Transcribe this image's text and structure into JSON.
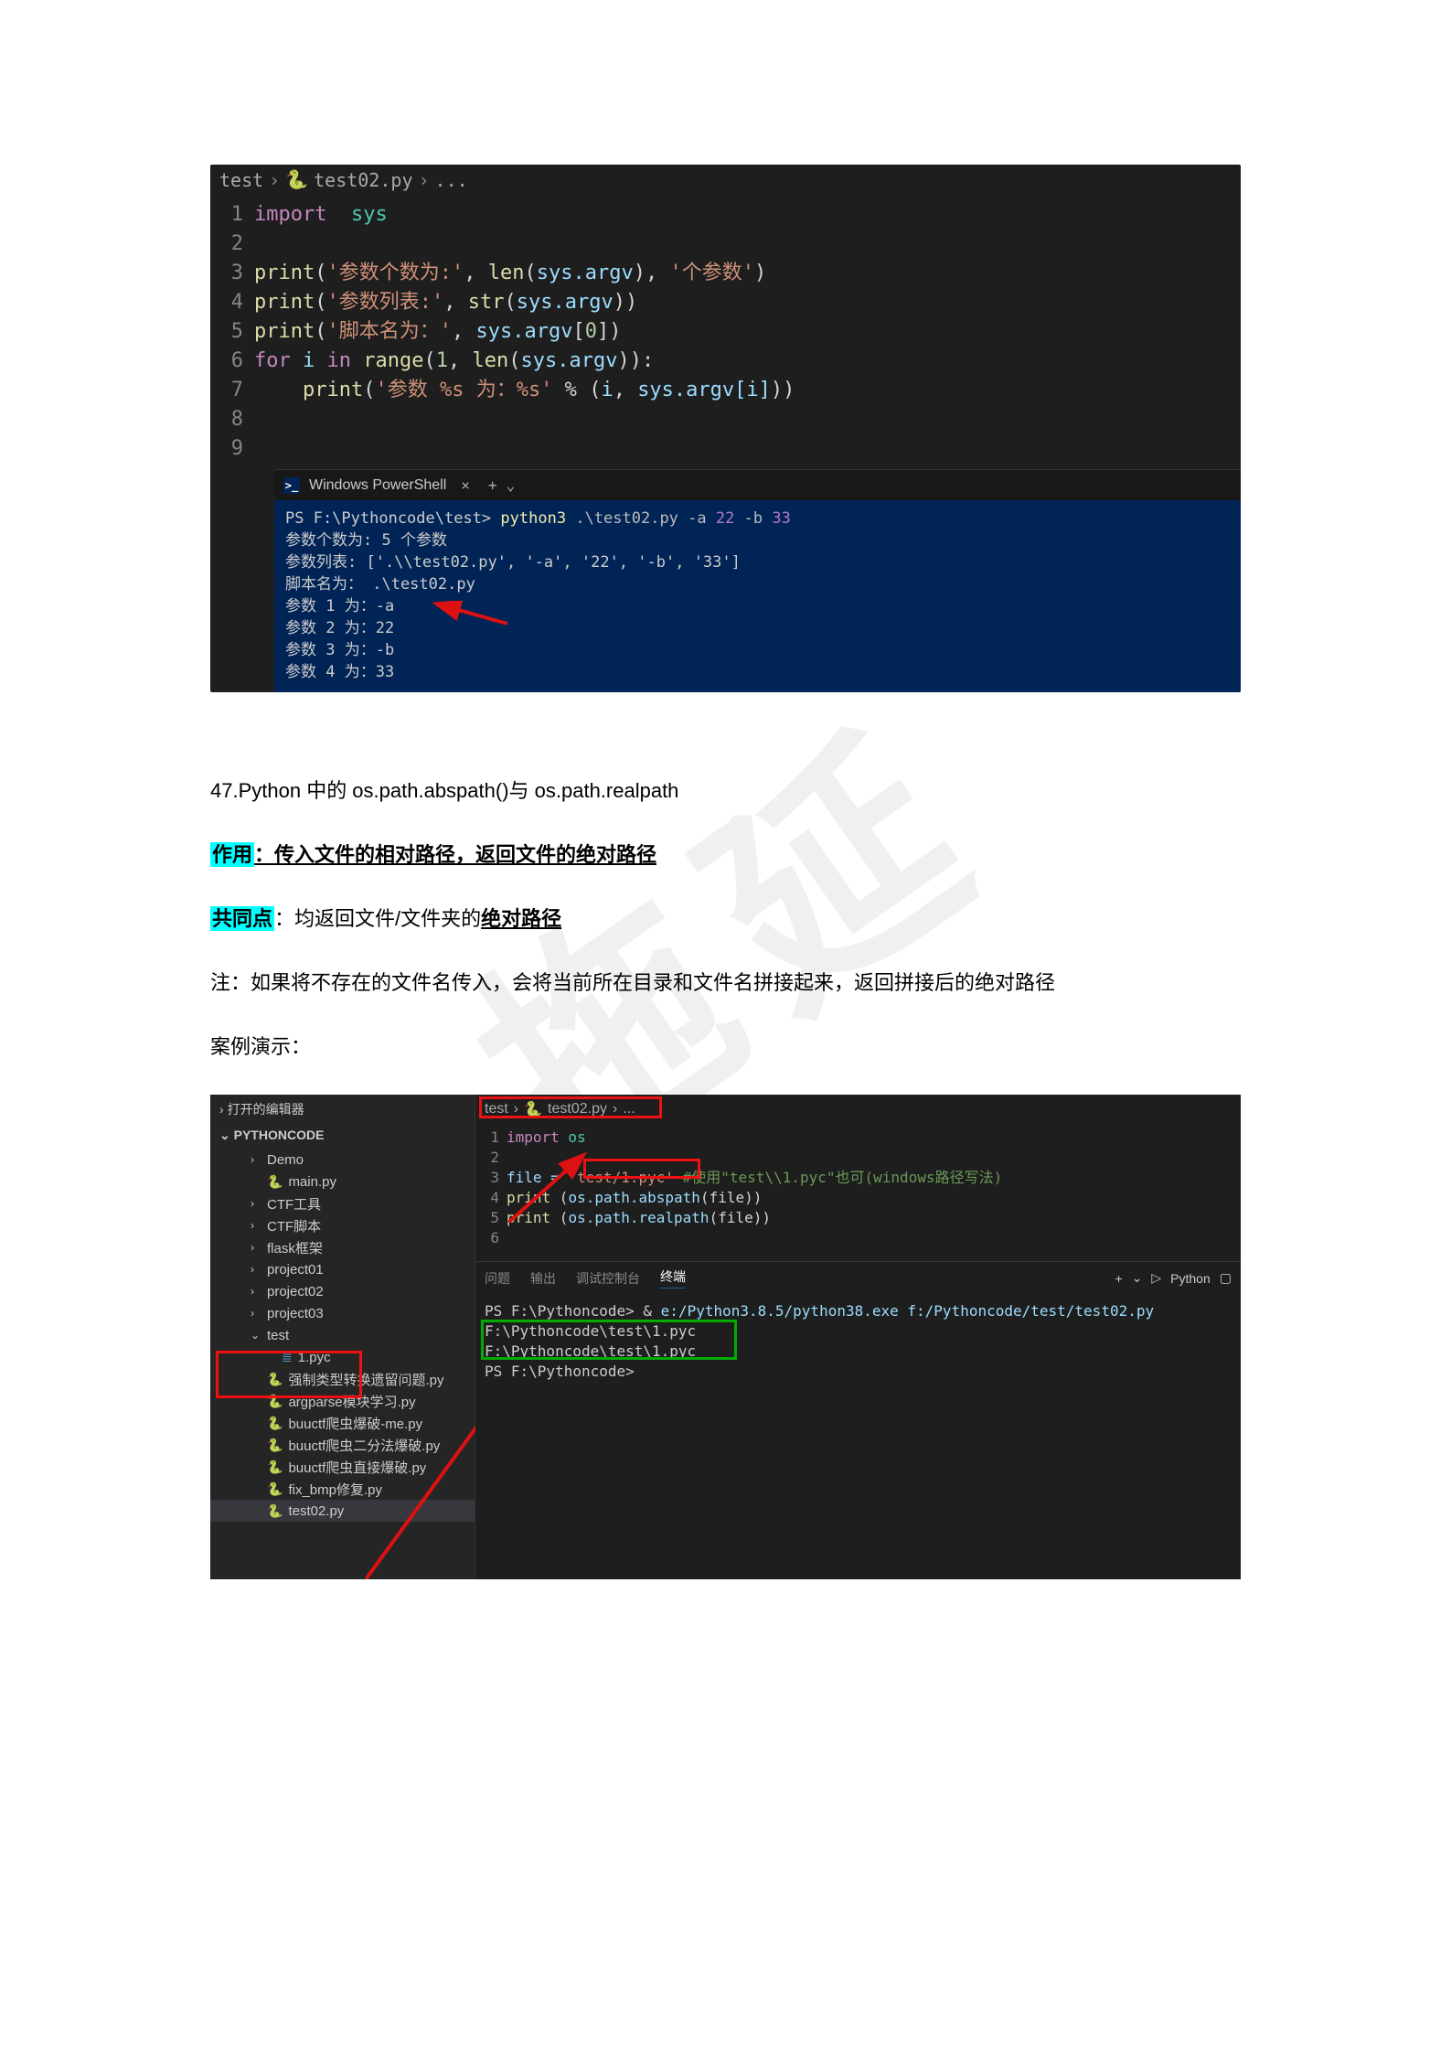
{
  "editor1": {
    "breadcrumb": {
      "folder": "test",
      "file": "test02.py",
      "dots": "..."
    },
    "lines": [
      "1",
      "2",
      "3",
      "4",
      "5",
      "6",
      "7",
      "8",
      "9"
    ],
    "code": {
      "l1_import": "import",
      "l1_sys": "  sys",
      "l3_print": "print",
      "l3_s1": "'参数个数为:'",
      "l3_len": "len",
      "l3_argv": "sys.argv",
      "l3_s2": "'个参数'",
      "l4_print": "print",
      "l4_s1": "'参数列表:'",
      "l4_str": "str",
      "l4_argv": "sys.argv",
      "l5_print": "print",
      "l5_s1": "'脚本名为：'",
      "l5_argv": "sys.argv",
      "l5_idx": "0",
      "l6_for": "for",
      "l6_i": "i",
      "l6_in": "in",
      "l6_range": "range",
      "l6_one": "1",
      "l6_len": "len",
      "l6_argv": "sys.argv",
      "l7_print": "print",
      "l7_s1": "'参数 %s 为：%s'",
      "l7_pct": " % ",
      "l7_i": "i",
      "l7_argvi": "sys.argv[i]"
    },
    "terminal": {
      "tab_title": "Windows PowerShell",
      "prompt": "PS F:\\Pythoncode\\test>",
      "cmd_py": "python3",
      "cmd_file": ".\\test02.py",
      "cmd_a": "-a",
      "cmd_22": "22",
      "cmd_b": "-b",
      "cmd_33": "33",
      "out1": "参数个数为: 5 个参数",
      "out2": "参数列表: ['.\\\\test02.py', '-a', '22', '-b', '33']",
      "out3": "脚本名为：   .\\test02.py",
      "out4": "参数 1 为：-a",
      "out5": "参数 2 为：22",
      "out6": "参数 3 为：-b",
      "out7": "参数 4 为：33"
    }
  },
  "body": {
    "line47": "47.Python 中的 os.path.abspath()与 os.path.realpath",
    "zuoyong_label": "作用",
    "zuoyong_text": "：传入文件的相对路径，返回文件的绝对路径",
    "gongtong_label": "共同点",
    "gongtong_text1": "：均返回文件/文件夹的",
    "gongtong_text2": "绝对路径",
    "note": "注：如果将不存在的文件名传入，会将当前所在目录和文件名拼接起来，返回拼接后的绝对路径",
    "demo_label": "案例演示："
  },
  "vs2": {
    "sidebar": {
      "open_editors": "打开的编辑器",
      "root": "PYTHONCODE",
      "items": [
        {
          "label": "Demo",
          "caret": "›",
          "indent": "lvl2"
        },
        {
          "label": "main.py",
          "icon": true,
          "indent": "lvl2"
        },
        {
          "label": "CTF工具",
          "caret": "›",
          "indent": "lvl2"
        },
        {
          "label": "CTF脚本",
          "caret": "›",
          "indent": "lvl2"
        },
        {
          "label": "flask框架",
          "caret": "›",
          "indent": "lvl2"
        },
        {
          "label": "project01",
          "caret": "›",
          "indent": "lvl2"
        },
        {
          "label": "project02",
          "caret": "›",
          "indent": "lvl2"
        },
        {
          "label": "project03",
          "caret": "›",
          "indent": "lvl2"
        },
        {
          "label": "test",
          "caret": "⌄",
          "indent": "lvl2"
        },
        {
          "label": "1.pyc",
          "icon": true,
          "indent": "lvl3",
          "hex": true
        },
        {
          "label": "强制类型转换遗留问题.py",
          "icon": true,
          "indent": "lvl2"
        },
        {
          "label": "argparse模块学习.py",
          "icon": true,
          "indent": "lvl2"
        },
        {
          "label": "buuctf爬虫爆破-me.py",
          "icon": true,
          "indent": "lvl2"
        },
        {
          "label": "buuctf爬虫二分法爆破.py",
          "icon": true,
          "indent": "lvl2"
        },
        {
          "label": "buuctf爬虫直接爆破.py",
          "icon": true,
          "indent": "lvl2"
        },
        {
          "label": "fix_bmp修复.py",
          "icon": true,
          "indent": "lvl2"
        },
        {
          "label": "test02.py",
          "icon": true,
          "indent": "lvl2",
          "sel": true
        }
      ]
    },
    "breadcrumb": {
      "folder": "test",
      "file": "test02.py",
      "dots": "..."
    },
    "code": {
      "lines": [
        "1",
        "2",
        "3",
        "4",
        "5",
        "6"
      ],
      "l1_import": "import",
      "l1_os": " os",
      "l3_file": "file = ",
      "l3_str": "'test/1.pyc'",
      "l3_cmnt": " #使用\"test\\\\1.pyc\"也可(windows路径写法)",
      "l4": "print (os.path.abspath(file))",
      "l5": "print (os.path.realpath(file))"
    },
    "panel": {
      "tabs": [
        "问题",
        "输出",
        "调试控制台",
        "终端"
      ],
      "right_plus": "+",
      "right_lang": "Python"
    },
    "term": {
      "l1_prompt": "PS F:\\Pythoncode>",
      "l1_amp": " & ",
      "l1_green": " e:/Python3.8.5/python38.exe f:/Pythoncode/test/test02.py",
      "l2": "F:\\Pythoncode\\test\\1.pyc",
      "l3": "F:\\Pythoncode\\test\\1.pyc",
      "l4": "PS F:\\Pythoncode>"
    }
  },
  "watermark": "拖延"
}
